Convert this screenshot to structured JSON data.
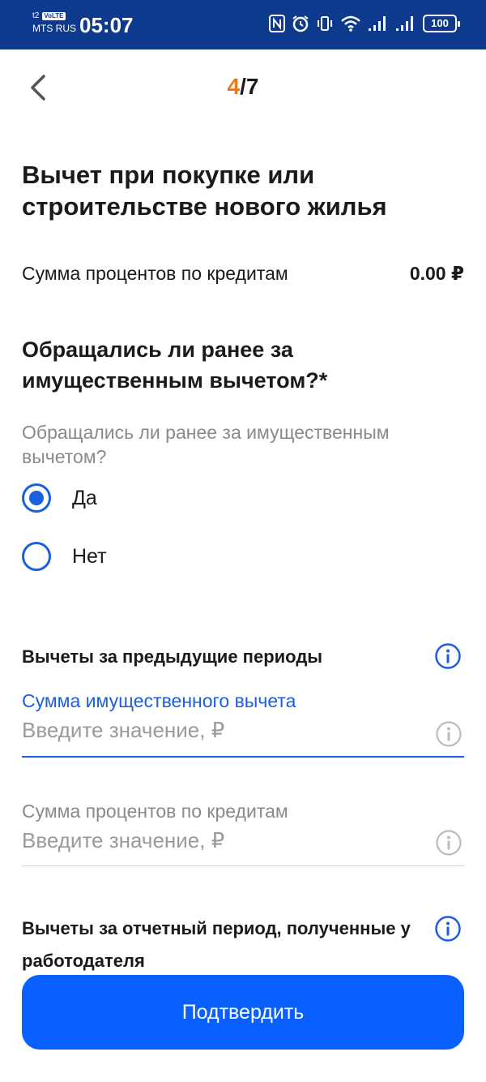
{
  "status_bar": {
    "carrier_top": "t2",
    "volte": "VoLTE",
    "carrier": "MTS RUS",
    "time": "05:07",
    "battery": "100"
  },
  "header": {
    "step_current": "4",
    "step_total": "/7"
  },
  "title": "Вычет при покупке или строительстве нового жилья",
  "interest_row": {
    "label": "Сумма процентов по кредитам",
    "value": "0.00 ₽"
  },
  "question": {
    "title": "Обращались ли ранее за имущественным вычетом?*",
    "subtitle": "Обращались ли ранее за имущественным вычетом?",
    "options": [
      {
        "label": "Да",
        "selected": true
      },
      {
        "label": "Нет",
        "selected": false
      }
    ]
  },
  "previous_periods": {
    "heading": "Вычеты за предыдущие периоды",
    "fields": [
      {
        "label": "Сумма имущественного вычета",
        "placeholder": "Введите значение, ₽",
        "value": ""
      },
      {
        "label": "Сумма процентов по кредитам",
        "placeholder": "Введите значение, ₽",
        "value": ""
      }
    ]
  },
  "employer_section": {
    "heading": "Вычеты за отчетный период, полученные у работодателя"
  },
  "confirm_label": "Подтвердить",
  "colors": {
    "status_bar": "#0d3a8c",
    "accent": "#1a5fe0",
    "button": "#0a60ff",
    "step_highlight": "#f07814"
  }
}
